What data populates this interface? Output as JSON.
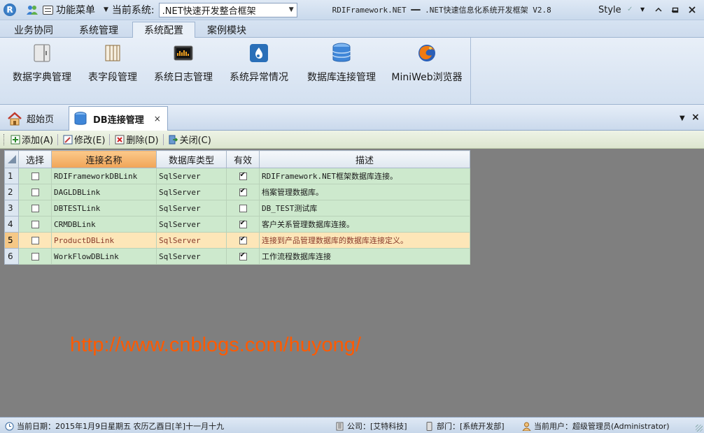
{
  "titlebar": {
    "function_menu": "功能菜单",
    "current_system_label": "当前系统:",
    "current_system_value": ".NET快速开发整合框架",
    "window_title": "RDIFramework.NET ━━ .NET快速信息化系统开发框架 V2.8",
    "style_label": "Style"
  },
  "ribbon": {
    "tabs": [
      {
        "label": "业务协同"
      },
      {
        "label": "系统管理"
      },
      {
        "label": "系统配置"
      },
      {
        "label": "案例模块"
      }
    ],
    "active_tab": "系统配置",
    "buttons": [
      {
        "label": "数据字典管理",
        "icon": "dictionary-icon"
      },
      {
        "label": "表字段管理",
        "icon": "table-fields-icon"
      },
      {
        "label": "系统日志管理",
        "icon": "log-icon"
      },
      {
        "label": "系统异常情况",
        "icon": "exception-icon"
      },
      {
        "label": "数据库连接管理",
        "icon": "database-icon"
      },
      {
        "label": "MiniWeb浏览器",
        "icon": "browser-icon"
      }
    ]
  },
  "doc_tabs": [
    {
      "label": "超始页",
      "icon": "home-icon"
    },
    {
      "label": "DB连接管理",
      "icon": "database-icon"
    }
  ],
  "toolbar": {
    "add": "添加(A)",
    "edit": "修改(E)",
    "delete": "删除(D)",
    "close": "关闭(C)"
  },
  "grid": {
    "columns": [
      "选择",
      "连接名称",
      "数据库类型",
      "有效",
      "描述"
    ],
    "rows": [
      {
        "n": "1",
        "selected": false,
        "name": "RDIFrameworkDBLink",
        "type": "SqlServer",
        "valid": true,
        "desc": "RDIFramework.NET框架数据库连接。"
      },
      {
        "n": "2",
        "selected": false,
        "name": "DAGLDBLink",
        "type": "SqlServer",
        "valid": true,
        "desc": "档案管理数据库。"
      },
      {
        "n": "3",
        "selected": false,
        "name": "DBTESTLink",
        "type": "SqlServer",
        "valid": false,
        "desc": "DB_TEST测试库"
      },
      {
        "n": "4",
        "selected": false,
        "name": "CRMDBLink",
        "type": "SqlServer",
        "valid": true,
        "desc": "客户关系管理数据库连接。"
      },
      {
        "n": "5",
        "selected": false,
        "name": "ProductDBLink",
        "type": "SqlServer",
        "valid": true,
        "desc": "连接到产品管理数据库的数据库连接定义。"
      },
      {
        "n": "6",
        "selected": false,
        "name": "WorkFlowDBLink",
        "type": "SqlServer",
        "valid": true,
        "desc": "工作流程数据库连接"
      }
    ],
    "highlighted_row": "5"
  },
  "watermark": "http://www.cnblogs.com/huyong/",
  "statusbar": {
    "date": "当前日期：2015年1月9日星期五 农历乙酉日[羊]十一月十九",
    "company": "公司：[艾特科技]",
    "department": "部门：[系统开发部]",
    "user": "当前用户：超级管理员(Administrator)"
  }
}
